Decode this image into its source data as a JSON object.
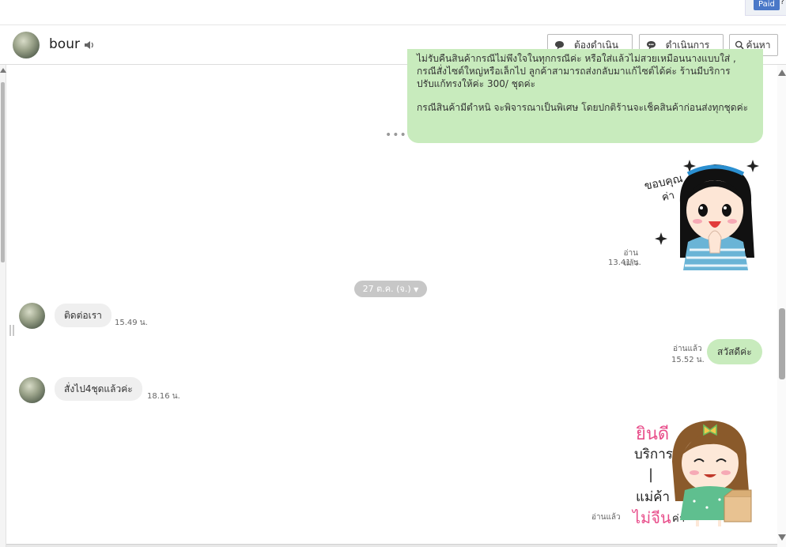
{
  "topbar": {
    "paid_label": "Paid",
    "paid_suffix": "?"
  },
  "header": {
    "contact_name": "bour",
    "buttons": {
      "todo": "ต้องดำเนินการ",
      "done": "ดำเนินการแล้ว",
      "search": "ค้นหา"
    }
  },
  "conversation": {
    "big_message": {
      "line_cut": "ไม่รับคืนสินค้ากรณีไม่พึงใจในทุกกรณีค่ะ หรือใส่แล้วไม่สวยเหมือนนางแบบใส่ ,",
      "line_1": "กรณีสั่งไซต์ใหญ่หรือเล็กไป ลูกค้าสามารถส่งกลับมาแก้ไซต์ได้ค่ะ ร้านมีบริการ",
      "line_2": "ปรับแก้ทรงให้ค่ะ 300/ ชุดค่ะ",
      "line_3": "กรณีสินค้ามีตำหนิ จะพิจารณาเป็นพิเศษ โดยปกติร้านจะเช็คสินค้าก่อนส่งทุกชุดค่ะ"
    },
    "sticker1": {
      "text_top": "ขอบคุณ",
      "text_bottom": "ค่า",
      "read_label": "อ่านแล้ว",
      "time": "13.41 น."
    },
    "date_divider": "27 ต.ค. (จ.)",
    "msg_in_1": {
      "text": "ติดต่อเรา",
      "time": "15.49 น."
    },
    "msg_out_1": {
      "text": "สวัสดีค่ะ",
      "read_label": "อ่านแล้ว",
      "time": "15.52 น."
    },
    "msg_in_2": {
      "text": "สั่งไป4ชุดแล้วค่ะ",
      "time": "18.16 น."
    },
    "sticker2": {
      "line_1": "ยินดี",
      "line_2": "บริการ",
      "line_3": "|",
      "line_4": "แม่ค้า",
      "line_5": "ไม่จีน",
      "line_5_suffix": "ค่า",
      "read_label": "อ่านแล้ว"
    }
  },
  "colors": {
    "outgoing_bubble": "#c8ebbd",
    "incoming_bubble": "#efefef",
    "paid_badge": "#4a78c8",
    "date_pill": "#c7c7c7"
  }
}
